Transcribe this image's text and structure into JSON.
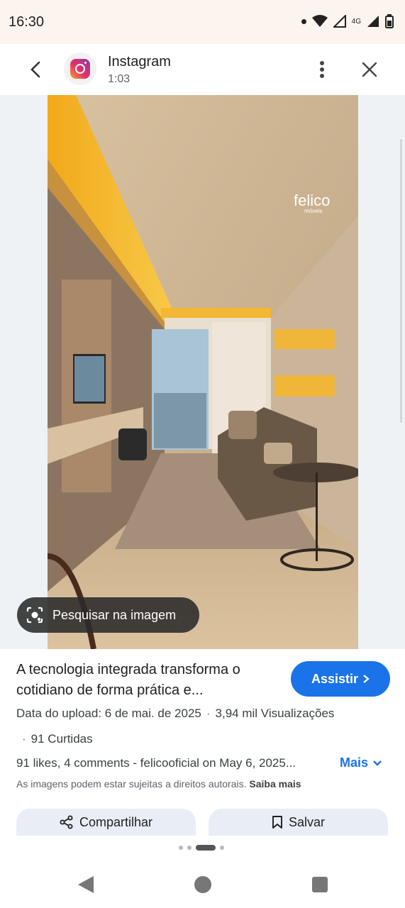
{
  "status_bar": {
    "time": "16:30",
    "network": "4G",
    "icons": [
      "dot-icon",
      "wifi-icon",
      "signal-icon",
      "battery-icon"
    ]
  },
  "header": {
    "title": "Instagram",
    "subtitle": "1:03",
    "icons": [
      "back-arrow-icon",
      "instagram-logo-icon",
      "more-vert-icon",
      "close-icon"
    ]
  },
  "image": {
    "watermark": "felico",
    "watermark_sub": "móveis",
    "search_chip_label": "Pesquisar na imagem"
  },
  "result": {
    "title_line1": "A tecnologia integrada transforma o",
    "title_line2": "cotidiano de forma prática e...",
    "watch_label": "Assistir",
    "upload": "Data do upload: 6 de mai. de 2025",
    "views": "3,94 mil Visualizações",
    "likes": "91 Curtidas",
    "description": "91 likes, 4 comments - felicooficial on May 6, 2025...",
    "more_label": "Mais",
    "copyright": "As imagens podem estar sujeitas a direitos autorais.",
    "learn_more": "Saiba mais"
  },
  "actions": {
    "share_label": "Compartilhar",
    "save_label": "Salvar"
  },
  "pager": {
    "count": 4,
    "active_index": 2
  },
  "colors": {
    "accent": "#1a73e8",
    "status_bg": "#fcf4ef",
    "chip_bg": "#e9eef6"
  }
}
